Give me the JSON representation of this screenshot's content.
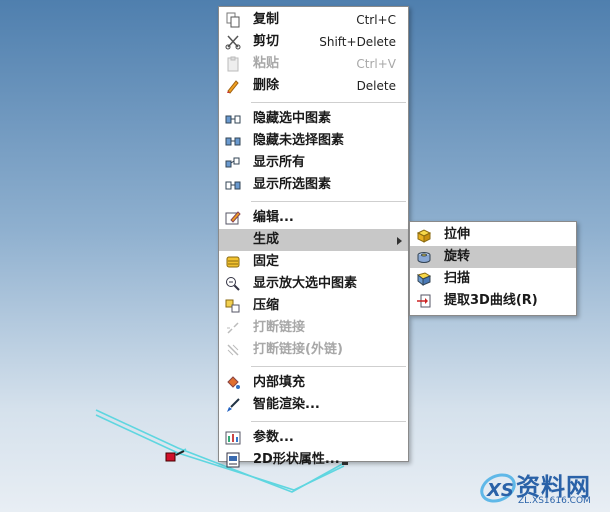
{
  "context_menu": {
    "copy": {
      "label": "复制",
      "shortcut": "Ctrl+C",
      "icon": "copy-icon"
    },
    "cut": {
      "label": "剪切",
      "shortcut": "Shift+Delete",
      "icon": "scissors-icon"
    },
    "paste": {
      "label": "粘贴",
      "shortcut": "Ctrl+V",
      "icon": "paste-icon",
      "disabled": true
    },
    "delete": {
      "label": "删除",
      "shortcut": "Delete",
      "icon": "pencil-icon"
    },
    "hide_selected": {
      "label": "隐藏选中图素",
      "icon": "hide-selected-icon"
    },
    "hide_unselected": {
      "label": "隐藏未选择图素",
      "icon": "hide-unselected-icon"
    },
    "show_all": {
      "label": "显示所有",
      "icon": "show-all-icon"
    },
    "show_selected": {
      "label": "显示所选图素",
      "icon": "show-selected-icon"
    },
    "edit": {
      "label": "编辑...",
      "icon": "edit-icon"
    },
    "generate": {
      "label": "生成",
      "icon": "none",
      "highlighted": true
    },
    "fix": {
      "label": "固定",
      "icon": "fix-icon"
    },
    "zoom_selected": {
      "label": "显示放大选中图素",
      "icon": "zoom-icon"
    },
    "compress": {
      "label": "压缩",
      "icon": "compress-icon"
    },
    "break_link": {
      "label": "打断链接",
      "icon": "break-link-icon",
      "disabled": true
    },
    "break_link_external": {
      "label": "打断链接(外链)",
      "icon": "break-external-link-icon",
      "disabled": true
    },
    "inner_fill": {
      "label": "内部填充",
      "icon": "fill-bucket-icon"
    },
    "smart_render": {
      "label": "智能渲染...",
      "icon": "paintbrush-icon"
    },
    "params": {
      "label": "参数...",
      "icon": "parameters-icon"
    },
    "shape_props": {
      "label": "2D形状属性...",
      "icon": "shape-properties-icon"
    }
  },
  "submenu": {
    "extrude": {
      "label": "拉伸",
      "icon": "extrude-icon"
    },
    "revolve": {
      "label": "旋转",
      "icon": "revolve-icon",
      "highlighted": true
    },
    "sweep": {
      "label": "扫描",
      "icon": "sweep-icon"
    },
    "extract_3d": {
      "label": "提取3D曲线(R)",
      "icon": "extract-curve-icon"
    }
  },
  "watermark": {
    "title": "资料网",
    "url": "ZL.XS1616.COM"
  },
  "colors": {
    "wireframe": "#5fd6e0",
    "handle": "#d0102a",
    "highlight": "#c8c8c8",
    "watermark": "#2a62a8"
  }
}
